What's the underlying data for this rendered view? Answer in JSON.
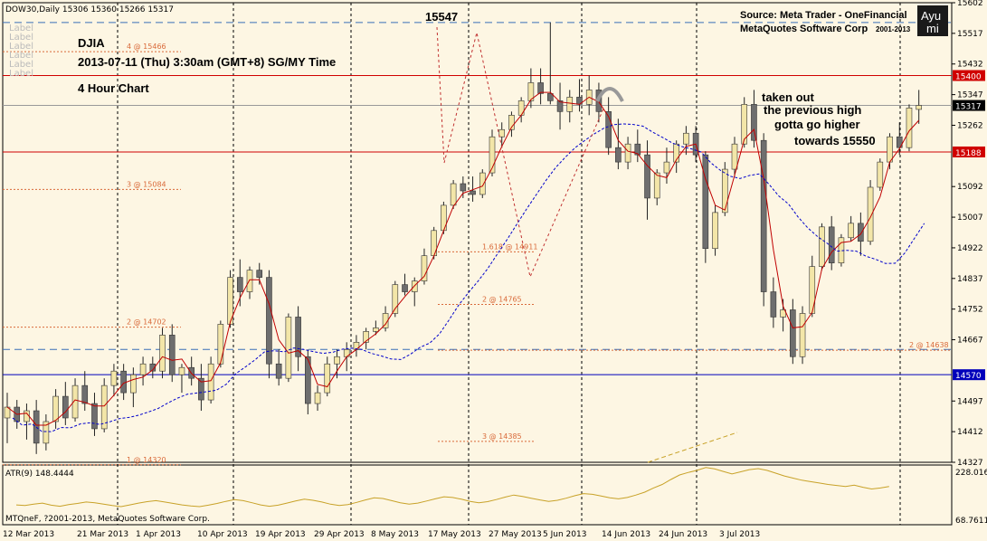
{
  "header": {
    "symbol_line": "DOW30,Daily  15306 15360 15266 15317",
    "source_line1": "Source: Meta Trader - OneFinancial",
    "source_line2": "MetaQuotes Software Corp",
    "source_years": "2001-2013",
    "logo_top": "Ayu",
    "logo_bottom": "mi"
  },
  "notes": {
    "ticker": "DJIA",
    "date": "2013-07-11 (Thu) 3:30am (GMT+8) SG/MY Time",
    "timeframe": "4 Hour Chart",
    "peak": "15547",
    "comment": [
      "taken out",
      "the previous high",
      "gotta go higher",
      "towards 15550"
    ]
  },
  "footer_copy": "MTQneF, ?2001-2013, MetaQuotes Software Corp.",
  "label_stack": [
    "Label",
    "Label",
    "Label",
    "Label",
    "Label",
    "Label"
  ],
  "colors": {
    "background": "#fdf6e3",
    "candle_up": "#f3e6a8",
    "candle_down": "#6e6e6e",
    "ma_fast": "#c00000",
    "ma_slow": "#0000cc",
    "atr": "#c8a228",
    "resistance": "#d00000",
    "support": "#0000bb",
    "fib": "#d96a3a"
  },
  "chart_data": {
    "type": "candlestick",
    "x_axis_labels": [
      "12 Mar 2013",
      "21 Mar 2013",
      "1 Apr 2013",
      "10 Apr 2013",
      "19 Apr 2013",
      "29 Apr 2013",
      "8 May 2013",
      "17 May 2013",
      "27 May 2013",
      "5 Jun 2013",
      "14 Jun 2013",
      "24 Jun 2013",
      "3 Jul 2013"
    ],
    "y_axis_ticks": [
      15602,
      15517,
      15432,
      15347,
      15262,
      15092,
      15007,
      14922,
      14837,
      14752,
      14667,
      14497,
      14412,
      14327
    ],
    "ylim": [
      14327,
      15602
    ],
    "last_price": 15317,
    "price_tags": [
      15400,
      15317,
      15188,
      14570
    ],
    "horizontal_lines": [
      {
        "price": 15400,
        "style": "resistance"
      },
      {
        "price": 15188,
        "style": "resistance"
      },
      {
        "price": 14570,
        "style": "support"
      },
      {
        "price": 15317,
        "style": "last"
      },
      {
        "price": 15547,
        "style": "dashed-blue"
      },
      {
        "price": 14640,
        "style": "dashed-blue"
      }
    ],
    "fib_levels": [
      {
        "text": "4 @ 15466",
        "price": 15466,
        "side": "left"
      },
      {
        "text": "3 @ 15084",
        "price": 15084,
        "side": "left"
      },
      {
        "text": "2 @ 14702",
        "price": 14702,
        "side": "left"
      },
      {
        "text": "1 @ 14320",
        "price": 14320,
        "side": "left"
      },
      {
        "text": "1.618 @ 14911",
        "price": 14911,
        "side": "mid"
      },
      {
        "text": "2 @ 14765",
        "price": 14765,
        "side": "mid"
      },
      {
        "text": "3 @ 14385",
        "price": 14385,
        "side": "mid"
      },
      {
        "text": "2 @ 14638",
        "price": 14638,
        "side": "right"
      }
    ],
    "candles": [
      [
        14450,
        14520,
        14380,
        14480
      ],
      [
        14480,
        14500,
        14420,
        14440
      ],
      [
        14440,
        14490,
        14390,
        14470
      ],
      [
        14470,
        14500,
        14350,
        14380
      ],
      [
        14380,
        14460,
        14360,
        14440
      ],
      [
        14440,
        14530,
        14420,
        14510
      ],
      [
        14510,
        14550,
        14430,
        14450
      ],
      [
        14450,
        14560,
        14440,
        14540
      ],
      [
        14540,
        14580,
        14470,
        14490
      ],
      [
        14490,
        14520,
        14400,
        14420
      ],
      [
        14420,
        14560,
        14410,
        14540
      ],
      [
        14540,
        14600,
        14510,
        14580
      ],
      [
        14580,
        14600,
        14500,
        14520
      ],
      [
        14520,
        14590,
        14480,
        14570
      ],
      [
        14570,
        14620,
        14540,
        14600
      ],
      [
        14600,
        14620,
        14560,
        14580
      ],
      [
        14580,
        14700,
        14560,
        14680
      ],
      [
        14680,
        14710,
        14550,
        14570
      ],
      [
        14570,
        14600,
        14520,
        14590
      ],
      [
        14590,
        14620,
        14540,
        14560
      ],
      [
        14560,
        14600,
        14470,
        14500
      ],
      [
        14500,
        14620,
        14490,
        14600
      ],
      [
        14600,
        14720,
        14590,
        14710
      ],
      [
        14710,
        14860,
        14700,
        14840
      ],
      [
        14840,
        14890,
        14760,
        14800
      ],
      [
        14800,
        14870,
        14780,
        14860
      ],
      [
        14860,
        14880,
        14820,
        14840
      ],
      [
        14840,
        14860,
        14560,
        14600
      ],
      [
        14600,
        14640,
        14540,
        14560
      ],
      [
        14560,
        14740,
        14550,
        14730
      ],
      [
        14730,
        14760,
        14580,
        14620
      ],
      [
        14620,
        14640,
        14460,
        14490
      ],
      [
        14490,
        14540,
        14470,
        14520
      ],
      [
        14520,
        14620,
        14510,
        14600
      ],
      [
        14600,
        14640,
        14560,
        14620
      ],
      [
        14620,
        14660,
        14580,
        14640
      ],
      [
        14640,
        14680,
        14620,
        14660
      ],
      [
        14660,
        14700,
        14640,
        14690
      ],
      [
        14690,
        14720,
        14680,
        14700
      ],
      [
        14700,
        14760,
        14690,
        14740
      ],
      [
        14740,
        14830,
        14730,
        14820
      ],
      [
        14820,
        14850,
        14790,
        14800
      ],
      [
        14800,
        14840,
        14760,
        14830
      ],
      [
        14830,
        14920,
        14820,
        14900
      ],
      [
        14900,
        14980,
        14890,
        14970
      ],
      [
        14970,
        15050,
        14960,
        15040
      ],
      [
        15040,
        15110,
        15030,
        15100
      ],
      [
        15100,
        15120,
        15060,
        15080
      ],
      [
        15080,
        15120,
        15050,
        15070
      ],
      [
        15070,
        15140,
        15060,
        15130
      ],
      [
        15130,
        15250,
        15120,
        15230
      ],
      [
        15230,
        15270,
        15200,
        15250
      ],
      [
        15250,
        15300,
        15230,
        15290
      ],
      [
        15290,
        15340,
        15270,
        15330
      ],
      [
        15330,
        15420,
        15310,
        15380
      ],
      [
        15380,
        15420,
        15320,
        15350
      ],
      [
        15350,
        15547,
        15320,
        15330
      ],
      [
        15330,
        15380,
        15250,
        15300
      ],
      [
        15300,
        15360,
        15270,
        15340
      ],
      [
        15340,
        15390,
        15300,
        15320
      ],
      [
        15320,
        15400,
        15290,
        15360
      ],
      [
        15360,
        15380,
        15270,
        15300
      ],
      [
        15300,
        15340,
        15180,
        15200
      ],
      [
        15200,
        15280,
        15140,
        15160
      ],
      [
        15160,
        15230,
        15140,
        15210
      ],
      [
        15210,
        15250,
        15160,
        15180
      ],
      [
        15180,
        15220,
        15000,
        15060
      ],
      [
        15060,
        15140,
        15040,
        15130
      ],
      [
        15130,
        15200,
        15100,
        15160
      ],
      [
        15160,
        15220,
        15130,
        15210
      ],
      [
        15210,
        15260,
        15180,
        15240
      ],
      [
        15240,
        15260,
        15160,
        15180
      ],
      [
        15180,
        15190,
        14880,
        14920
      ],
      [
        14920,
        15040,
        14900,
        15020
      ],
      [
        15020,
        15160,
        15010,
        15140
      ],
      [
        15140,
        15230,
        15120,
        15210
      ],
      [
        15210,
        15340,
        15200,
        15320
      ],
      [
        15320,
        15360,
        15200,
        15220
      ],
      [
        15220,
        15240,
        14760,
        14800
      ],
      [
        14800,
        14840,
        14700,
        14730
      ],
      [
        14730,
        14780,
        14690,
        14750
      ],
      [
        14750,
        14780,
        14600,
        14620
      ],
      [
        14620,
        14760,
        14600,
        14740
      ],
      [
        14740,
        14900,
        14730,
        14870
      ],
      [
        14870,
        14990,
        14860,
        14980
      ],
      [
        14980,
        15010,
        14860,
        14880
      ],
      [
        14880,
        14960,
        14870,
        14950
      ],
      [
        14950,
        15010,
        14940,
        14990
      ],
      [
        14990,
        15020,
        14900,
        14940
      ],
      [
        14940,
        15110,
        14930,
        15090
      ],
      [
        15090,
        15170,
        15080,
        15160
      ],
      [
        15160,
        15240,
        15140,
        15230
      ],
      [
        15230,
        15270,
        15180,
        15200
      ],
      [
        15200,
        15320,
        15190,
        15310
      ],
      [
        15306,
        15360,
        15266,
        15317
      ]
    ],
    "atr": {
      "label": "ATR(9) 148.4444",
      "ticks": [
        228.0167,
        68.7611
      ],
      "ylim": [
        68.7611,
        228.0167
      ],
      "values": [
        120,
        118,
        122,
        125,
        119,
        116,
        121,
        124,
        128,
        126,
        122,
        118,
        115,
        120,
        125,
        129,
        132,
        128,
        124,
        120,
        117,
        115,
        119,
        124,
        130,
        135,
        132,
        126,
        120,
        116,
        119,
        125,
        131,
        136,
        133,
        128,
        122,
        118,
        121,
        127,
        134,
        140,
        138,
        132,
        126,
        122,
        125,
        131,
        137,
        143,
        141,
        136,
        130,
        126,
        129,
        135,
        142,
        148,
        144,
        139,
        134,
        130,
        133,
        139,
        146,
        152,
        150,
        145,
        140,
        137,
        141,
        148,
        156,
        168,
        178,
        192,
        205,
        212,
        218,
        226,
        222,
        215,
        208,
        214,
        220,
        223,
        218,
        210,
        202,
        196,
        190,
        186,
        182,
        178,
        175,
        172,
        176,
        170,
        165,
        168,
        172
      ]
    }
  }
}
